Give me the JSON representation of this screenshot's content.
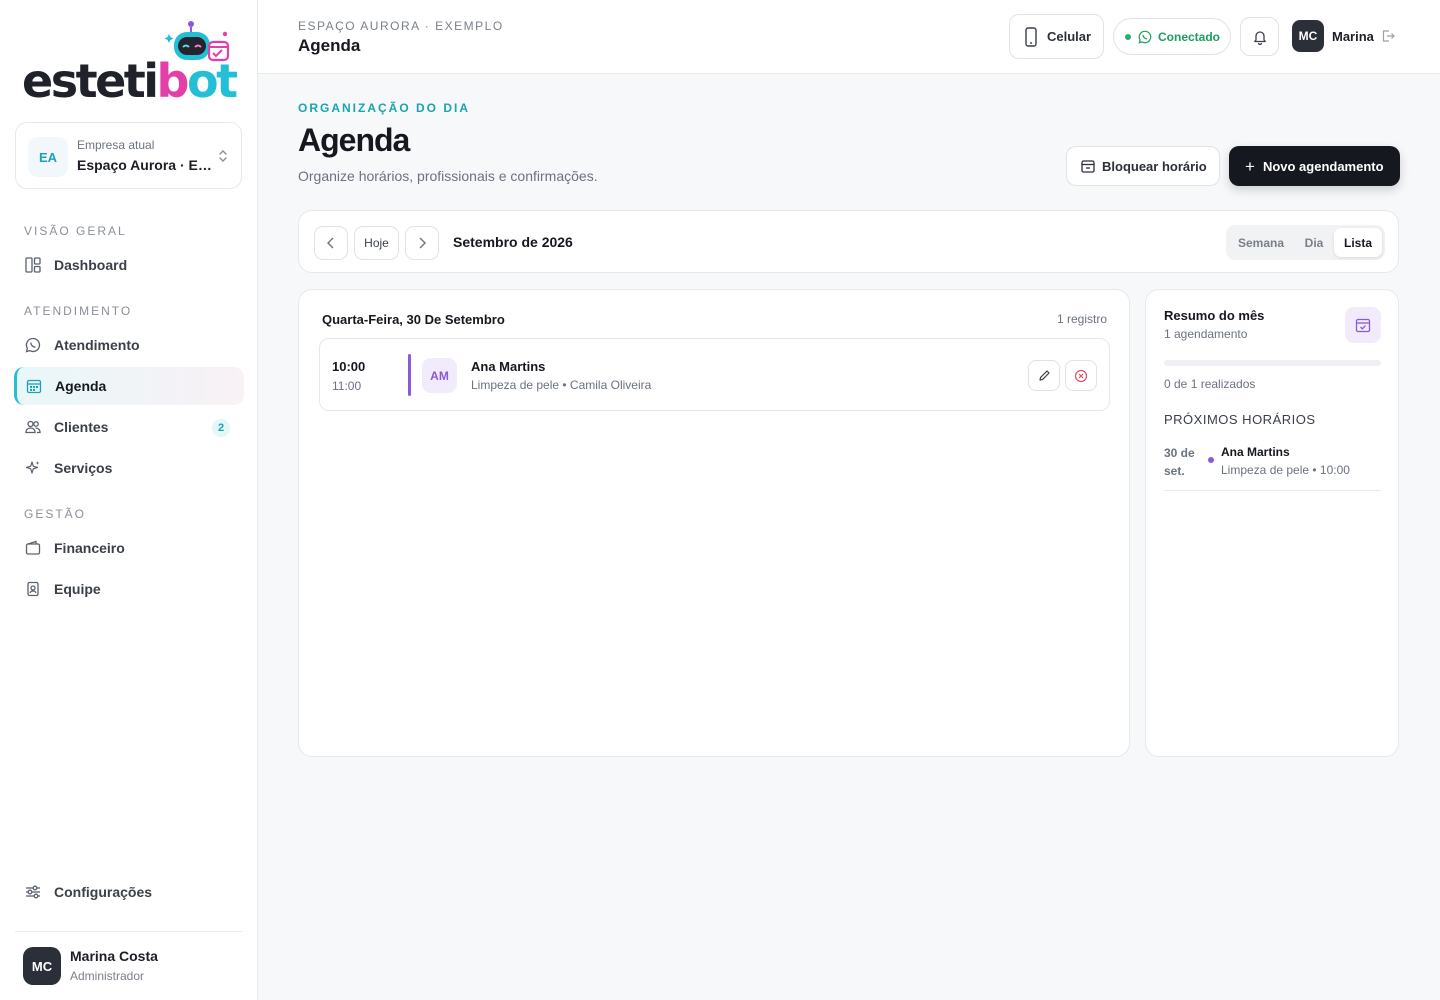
{
  "app": {
    "logo": {
      "part1": "esteti",
      "part2": "b",
      "part3": "ot"
    }
  },
  "company": {
    "label": "Empresa atual",
    "value": "Espaço Aurora · Exemplo",
    "initials": "EA"
  },
  "sidebar": {
    "sections": [
      {
        "title": "VISÃO GERAL"
      },
      {
        "title": "ATENDIMENTO"
      },
      {
        "title": "GESTÃO"
      }
    ],
    "items": [
      {
        "label": "Dashboard",
        "icon": "dashboard-icon"
      },
      {
        "label": "Atendimento",
        "icon": "whatsapp-icon"
      },
      {
        "label": "Agenda",
        "icon": "calendar-icon",
        "active": true
      },
      {
        "label": "Clientes",
        "icon": "users-icon",
        "count": "2"
      },
      {
        "label": "Serviços",
        "icon": "sparkles-icon"
      },
      {
        "label": "Financeiro",
        "icon": "wallet-icon"
      },
      {
        "label": "Equipe",
        "icon": "badge-icon"
      }
    ],
    "settings": {
      "label": "Configurações",
      "icon": "sliders-icon"
    },
    "user": {
      "initials": "MC",
      "name": "Marina Costa",
      "role": "Administrador"
    }
  },
  "topbar": {
    "breadcrumb": "ESPAÇO AURORA · EXEMPLO",
    "title": "Agenda",
    "device_label": "Celular",
    "status_label": "Conectado",
    "user_initials": "MC",
    "user_name": "Marina"
  },
  "header": {
    "eyebrow": "ORGANIZAÇÃO DO DIA",
    "title": "Agenda",
    "subtitle": "Organize horários, profissionais e confirmações.",
    "block_label": "Bloquear horário",
    "new_label": "Novo agendamento"
  },
  "calendar": {
    "today_label": "Hoje",
    "month": "Setembro de 2026",
    "views": [
      "Semana",
      "Dia",
      "Lista"
    ],
    "active_view": "Lista"
  },
  "list": {
    "day_title": "Quarta-Feira, 30 De Setembro",
    "count_label": "1 registro",
    "appointments": [
      {
        "start": "10:00",
        "end": "11:00",
        "initials": "AM",
        "client": "Ana Martins",
        "detail": "Limpeza de pele • Camila Oliveira"
      }
    ]
  },
  "summary": {
    "title": "Resumo do mês",
    "subtitle": "1 agendamento",
    "done_label": "0 de 1 realizados",
    "progress": 0,
    "next_title": "PRÓXIMOS HORÁRIOS",
    "next": [
      {
        "date": "30 de set.",
        "client": "Ana Martins",
        "detail": "Limpeza de pele • 10:00"
      }
    ]
  },
  "colors": {
    "accent": "#23c0d2",
    "brand_pink": "#e43fa8",
    "purple": "#8a5ad8",
    "success": "#1e9e5e",
    "dark": "#15181e"
  }
}
